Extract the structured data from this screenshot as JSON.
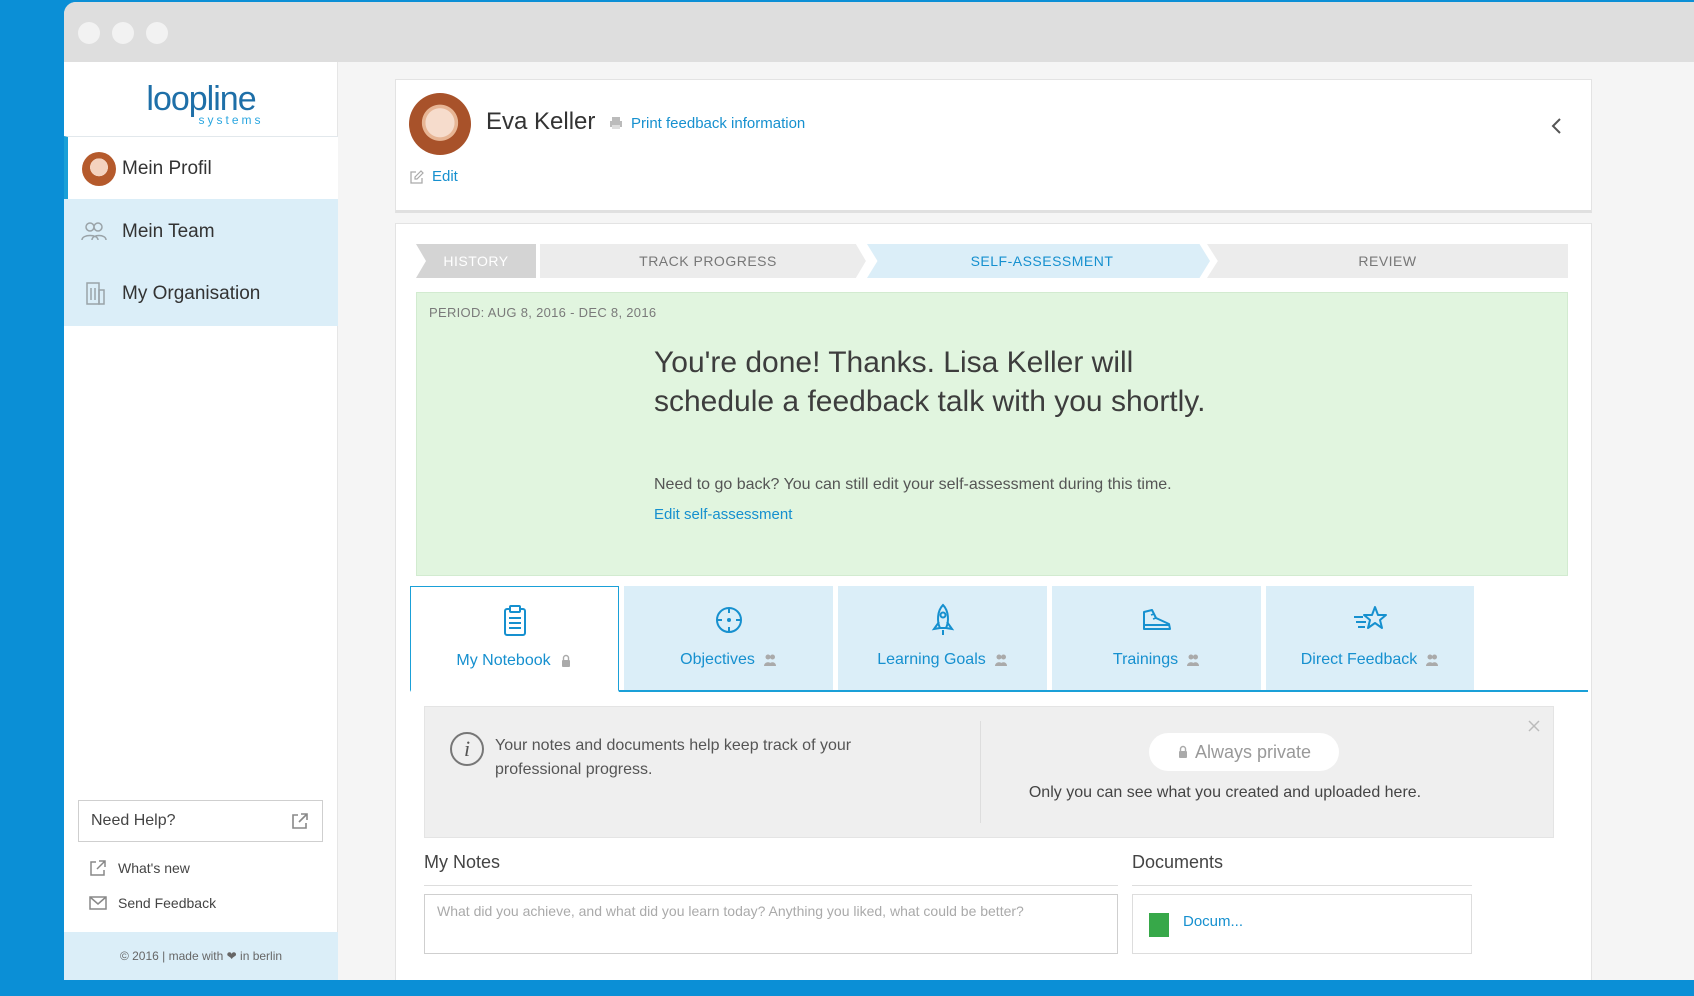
{
  "app": {
    "logo_main": "loopline",
    "logo_sub": "systems"
  },
  "sidebar": {
    "items": [
      {
        "label": "Mein Profil",
        "icon": "avatar",
        "active": true
      },
      {
        "label": "Mein Team",
        "icon": "team-icon"
      },
      {
        "label": "My Organisation",
        "icon": "building-icon"
      }
    ],
    "help_label": "Need Help?",
    "links": [
      {
        "label": "What's new",
        "icon": "external-link-icon"
      },
      {
        "label": "Send Feedback",
        "icon": "mail-icon"
      }
    ],
    "footer": "© 2016 | made with ❤ in berlin"
  },
  "profile": {
    "name": "Eva Keller",
    "print_label": "Print feedback information",
    "edit_label": "Edit"
  },
  "stepper": {
    "steps": [
      "HISTORY",
      "TRACK PROGRESS",
      "SELF-ASSESSMENT",
      "REVIEW"
    ],
    "active": "SELF-ASSESSMENT"
  },
  "banner": {
    "period": "PERIOD: AUG 8, 2016 - DEC 8, 2016",
    "title": "You're done! Thanks. Lisa Keller will schedule a feedback talk with you shortly.",
    "text": "Need to go back? You can still edit your self-assessment during this time.",
    "link": "Edit self-assessment"
  },
  "tabs": [
    {
      "label": "My Notebook",
      "icon": "clipboard-icon",
      "badge": "lock-icon",
      "active": true
    },
    {
      "label": "Objectives",
      "icon": "target-icon",
      "badge": "people-icon"
    },
    {
      "label": "Learning Goals",
      "icon": "rocket-icon",
      "badge": "people-icon"
    },
    {
      "label": "Trainings",
      "icon": "sneaker-icon",
      "badge": "people-icon"
    },
    {
      "label": "Direct Feedback",
      "icon": "star-icon",
      "badge": "people-icon"
    }
  ],
  "info": {
    "text": "Your notes and documents help keep track of your professional progress.",
    "private_label": "Always private",
    "private_desc": "Only you can see what you created and uploaded here."
  },
  "notes": {
    "title": "My Notes",
    "placeholder": "What did you achieve, and what did you learn today? Anything you liked, what could be better?"
  },
  "documents": {
    "title": "Documents",
    "first_item": "Docum..."
  },
  "colors": {
    "accent": "#1690cf",
    "background": "#0b8fd6",
    "banner": "#e1f5df",
    "tab_bg": "#dbeef8"
  }
}
